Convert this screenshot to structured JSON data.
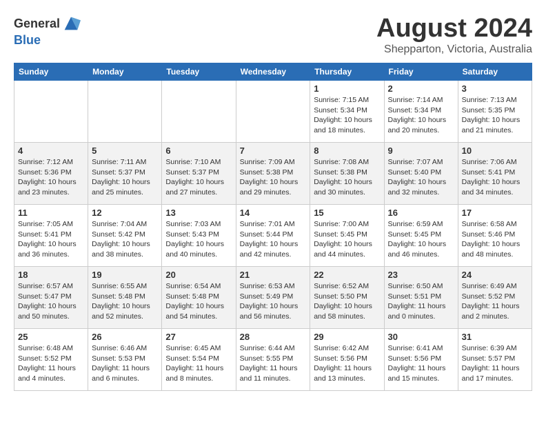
{
  "header": {
    "logo_general": "General",
    "logo_blue": "Blue",
    "month_year": "August 2024",
    "location": "Shepparton, Victoria, Australia"
  },
  "weekdays": [
    "Sunday",
    "Monday",
    "Tuesday",
    "Wednesday",
    "Thursday",
    "Friday",
    "Saturday"
  ],
  "weeks": [
    [
      {
        "day": "",
        "info": ""
      },
      {
        "day": "",
        "info": ""
      },
      {
        "day": "",
        "info": ""
      },
      {
        "day": "",
        "info": ""
      },
      {
        "day": "1",
        "info": "Sunrise: 7:15 AM\nSunset: 5:34 PM\nDaylight: 10 hours\nand 18 minutes."
      },
      {
        "day": "2",
        "info": "Sunrise: 7:14 AM\nSunset: 5:34 PM\nDaylight: 10 hours\nand 20 minutes."
      },
      {
        "day": "3",
        "info": "Sunrise: 7:13 AM\nSunset: 5:35 PM\nDaylight: 10 hours\nand 21 minutes."
      }
    ],
    [
      {
        "day": "4",
        "info": "Sunrise: 7:12 AM\nSunset: 5:36 PM\nDaylight: 10 hours\nand 23 minutes."
      },
      {
        "day": "5",
        "info": "Sunrise: 7:11 AM\nSunset: 5:37 PM\nDaylight: 10 hours\nand 25 minutes."
      },
      {
        "day": "6",
        "info": "Sunrise: 7:10 AM\nSunset: 5:37 PM\nDaylight: 10 hours\nand 27 minutes."
      },
      {
        "day": "7",
        "info": "Sunrise: 7:09 AM\nSunset: 5:38 PM\nDaylight: 10 hours\nand 29 minutes."
      },
      {
        "day": "8",
        "info": "Sunrise: 7:08 AM\nSunset: 5:38 PM\nDaylight: 10 hours\nand 30 minutes."
      },
      {
        "day": "9",
        "info": "Sunrise: 7:07 AM\nSunset: 5:40 PM\nDaylight: 10 hours\nand 32 minutes."
      },
      {
        "day": "10",
        "info": "Sunrise: 7:06 AM\nSunset: 5:41 PM\nDaylight: 10 hours\nand 34 minutes."
      }
    ],
    [
      {
        "day": "11",
        "info": "Sunrise: 7:05 AM\nSunset: 5:41 PM\nDaylight: 10 hours\nand 36 minutes."
      },
      {
        "day": "12",
        "info": "Sunrise: 7:04 AM\nSunset: 5:42 PM\nDaylight: 10 hours\nand 38 minutes."
      },
      {
        "day": "13",
        "info": "Sunrise: 7:03 AM\nSunset: 5:43 PM\nDaylight: 10 hours\nand 40 minutes."
      },
      {
        "day": "14",
        "info": "Sunrise: 7:01 AM\nSunset: 5:44 PM\nDaylight: 10 hours\nand 42 minutes."
      },
      {
        "day": "15",
        "info": "Sunrise: 7:00 AM\nSunset: 5:45 PM\nDaylight: 10 hours\nand 44 minutes."
      },
      {
        "day": "16",
        "info": "Sunrise: 6:59 AM\nSunset: 5:45 PM\nDaylight: 10 hours\nand 46 minutes."
      },
      {
        "day": "17",
        "info": "Sunrise: 6:58 AM\nSunset: 5:46 PM\nDaylight: 10 hours\nand 48 minutes."
      }
    ],
    [
      {
        "day": "18",
        "info": "Sunrise: 6:57 AM\nSunset: 5:47 PM\nDaylight: 10 hours\nand 50 minutes."
      },
      {
        "day": "19",
        "info": "Sunrise: 6:55 AM\nSunset: 5:48 PM\nDaylight: 10 hours\nand 52 minutes."
      },
      {
        "day": "20",
        "info": "Sunrise: 6:54 AM\nSunset: 5:48 PM\nDaylight: 10 hours\nand 54 minutes."
      },
      {
        "day": "21",
        "info": "Sunrise: 6:53 AM\nSunset: 5:49 PM\nDaylight: 10 hours\nand 56 minutes."
      },
      {
        "day": "22",
        "info": "Sunrise: 6:52 AM\nSunset: 5:50 PM\nDaylight: 10 hours\nand 58 minutes."
      },
      {
        "day": "23",
        "info": "Sunrise: 6:50 AM\nSunset: 5:51 PM\nDaylight: 11 hours\nand 0 minutes."
      },
      {
        "day": "24",
        "info": "Sunrise: 6:49 AM\nSunset: 5:52 PM\nDaylight: 11 hours\nand 2 minutes."
      }
    ],
    [
      {
        "day": "25",
        "info": "Sunrise: 6:48 AM\nSunset: 5:52 PM\nDaylight: 11 hours\nand 4 minutes."
      },
      {
        "day": "26",
        "info": "Sunrise: 6:46 AM\nSunset: 5:53 PM\nDaylight: 11 hours\nand 6 minutes."
      },
      {
        "day": "27",
        "info": "Sunrise: 6:45 AM\nSunset: 5:54 PM\nDaylight: 11 hours\nand 8 minutes."
      },
      {
        "day": "28",
        "info": "Sunrise: 6:44 AM\nSunset: 5:55 PM\nDaylight: 11 hours\nand 11 minutes."
      },
      {
        "day": "29",
        "info": "Sunrise: 6:42 AM\nSunset: 5:56 PM\nDaylight: 11 hours\nand 13 minutes."
      },
      {
        "day": "30",
        "info": "Sunrise: 6:41 AM\nSunset: 5:56 PM\nDaylight: 11 hours\nand 15 minutes."
      },
      {
        "day": "31",
        "info": "Sunrise: 6:39 AM\nSunset: 5:57 PM\nDaylight: 11 hours\nand 17 minutes."
      }
    ]
  ]
}
